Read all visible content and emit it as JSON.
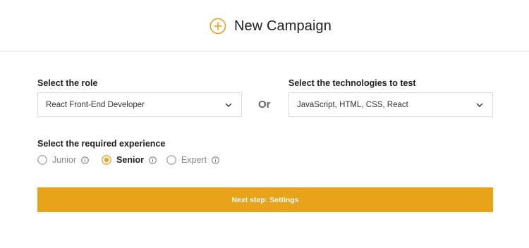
{
  "header": {
    "title": "New Campaign",
    "icon": "plus-circle-icon",
    "accent_color": "#e9a318"
  },
  "role": {
    "label": "Select the role",
    "value": "React Front-End Developer"
  },
  "separator": "Or",
  "technologies": {
    "label": "Select the technologies to test",
    "value": "JavaScript, HTML, CSS, React"
  },
  "experience": {
    "label": "Select the required experience",
    "options": [
      {
        "label": "Junior",
        "selected": false
      },
      {
        "label": "Senior",
        "selected": true
      },
      {
        "label": "Expert",
        "selected": false
      }
    ]
  },
  "next_button": {
    "label": "Next step: Settings",
    "color": "#e9a318"
  }
}
